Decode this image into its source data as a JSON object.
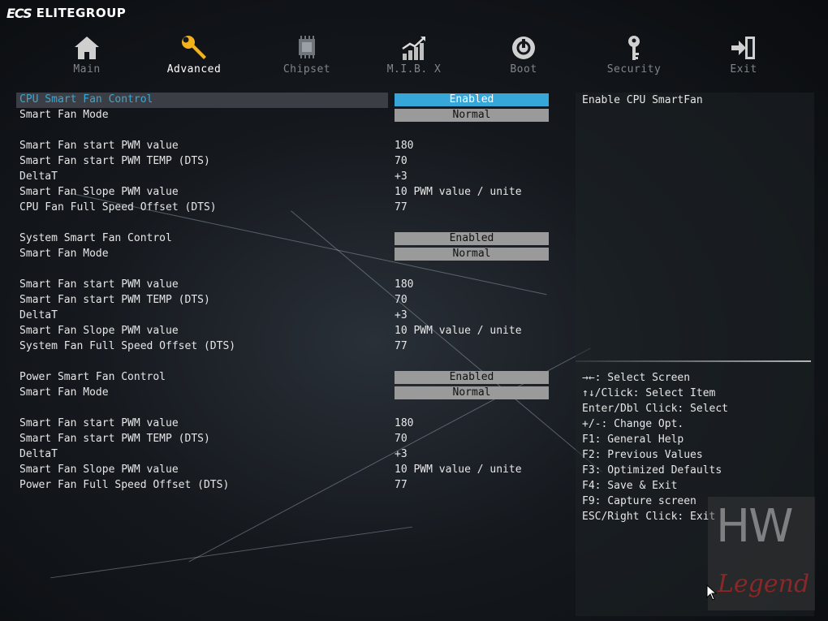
{
  "brand": {
    "logo": "ECS",
    "name": "ELITEGROUP"
  },
  "tabs": [
    {
      "label": "Main",
      "icon": "home-icon",
      "active": false
    },
    {
      "label": "Advanced",
      "icon": "wrench-icon",
      "active": true
    },
    {
      "label": "Chipset",
      "icon": "chip-icon",
      "active": false
    },
    {
      "label": "M.I.B. X",
      "icon": "performance-chart-icon",
      "active": false
    },
    {
      "label": "Boot",
      "icon": "power-icon",
      "active": false
    },
    {
      "label": "Security",
      "icon": "key-icon",
      "active": false
    },
    {
      "label": "Exit",
      "icon": "exit-icon",
      "active": false
    }
  ],
  "settings": [
    {
      "label": "CPU Smart Fan Control",
      "option": "Enabled",
      "selected": true
    },
    {
      "label": "Smart Fan Mode",
      "option": "Normal"
    },
    {
      "label": "Smart Fan start PWM value",
      "value": "180"
    },
    {
      "label": "Smart Fan start PWM TEMP (DTS)",
      "value": "70"
    },
    {
      "label": "DeltaT",
      "value": "+3"
    },
    {
      "label": "Smart Fan Slope PWM value",
      "value": "10 PWM value / unite"
    },
    {
      "label": "CPU Fan Full Speed Offset (DTS)",
      "value": "77"
    },
    {
      "label": "System Smart Fan Control",
      "option": "Enabled"
    },
    {
      "label": "Smart Fan Mode",
      "option": "Normal"
    },
    {
      "label": "Smart Fan start PWM value",
      "value": "180"
    },
    {
      "label": "Smart Fan start PWM TEMP (DTS)",
      "value": "70"
    },
    {
      "label": "DeltaT",
      "value": "+3"
    },
    {
      "label": "Smart Fan Slope PWM value",
      "value": "10 PWM value / unite"
    },
    {
      "label": "System Fan Full Speed Offset (DTS)",
      "value": "77"
    },
    {
      "label": "Power Smart Fan Control",
      "option": "Enabled"
    },
    {
      "label": "Smart Fan Mode",
      "option": "Normal"
    },
    {
      "label": "Smart Fan start PWM value",
      "value": "180"
    },
    {
      "label": "Smart Fan start PWM TEMP (DTS)",
      "value": "70"
    },
    {
      "label": "DeltaT",
      "value": "+3"
    },
    {
      "label": "Smart Fan Slope PWM value",
      "value": "10 PWM value / unite"
    },
    {
      "label": "Power Fan Full Speed Offset (DTS)",
      "value": "77"
    }
  ],
  "help": {
    "description": "Enable CPU SmartFan",
    "keys": [
      "→←: Select Screen",
      "↑↓/Click: Select Item",
      "Enter/Dbl Click: Select",
      "+/-: Change Opt.",
      "F1: General Help",
      "F2: Previous Values",
      "F3: Optimized Defaults",
      "F4: Save & Exit",
      "F9: Capture screen",
      "ESC/Right Click: Exit"
    ]
  },
  "watermark": {
    "top": "HW",
    "bottom": "Legend"
  },
  "colors": {
    "accent": "#36a7d8",
    "option_bg": "#9a9a9a",
    "selected_label": "#3aa7d4"
  }
}
